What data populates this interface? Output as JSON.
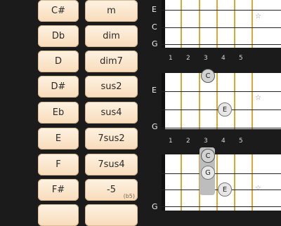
{
  "roots": [
    "C#",
    "Db",
    "D",
    "D#",
    "Eb",
    "E",
    "F",
    "F#",
    ""
  ],
  "types": [
    {
      "label": "m",
      "sub": ""
    },
    {
      "label": "dim",
      "sub": ""
    },
    {
      "label": "dim7",
      "sub": ""
    },
    {
      "label": "sus2",
      "sub": ""
    },
    {
      "label": "sus4",
      "sub": ""
    },
    {
      "label": "7sus2",
      "sub": ""
    },
    {
      "label": "7sus4",
      "sub": ""
    },
    {
      "label": "-5",
      "sub": "(b5)"
    },
    {
      "label": "",
      "sub": ""
    }
  ],
  "fret_numbers": [
    "1",
    "2",
    "3",
    "4",
    "5"
  ],
  "diagrams": [
    {
      "string_labels": [
        "E",
        "C",
        "G"
      ],
      "notes": [],
      "star": "☆"
    },
    {
      "string_labels": [
        "E",
        "",
        "G"
      ],
      "notes": [
        "C",
        "E"
      ],
      "star": "☆"
    },
    {
      "string_labels": [
        "",
        "",
        "G"
      ],
      "notes": [
        "C",
        "G",
        "E"
      ],
      "star": "☆"
    }
  ]
}
